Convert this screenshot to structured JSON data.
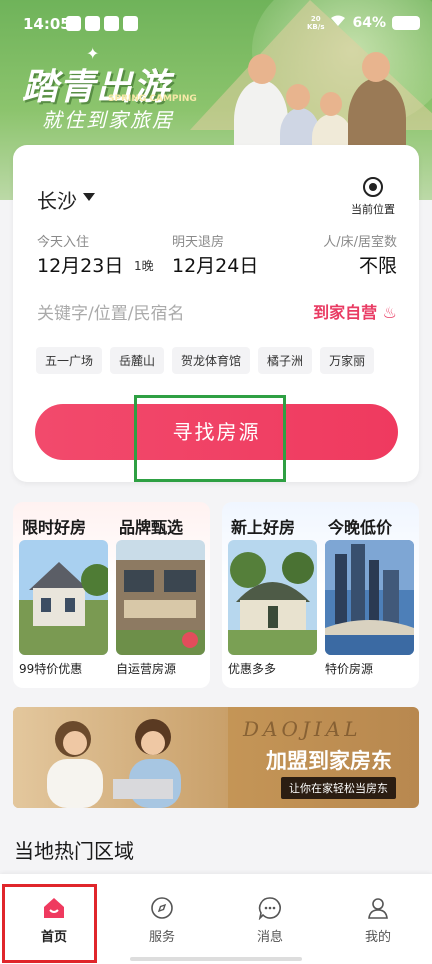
{
  "status_bar": {
    "time": "14:05",
    "net_speed": "20",
    "net_unit": "KB/s",
    "battery": "64%"
  },
  "hero": {
    "slogan_main": "踏青出游",
    "slogan_en": "SPRING CAMPING",
    "slogan_sub": "就住到家旅居"
  },
  "search": {
    "city": "长沙",
    "current_location": "当前位置",
    "checkin_label": "今天入住",
    "checkin_date": "12月23日",
    "nights": "1晚",
    "checkout_label": "明天退房",
    "checkout_date": "12月24日",
    "guests_label": "人/床/居室数",
    "guests_value": "不限",
    "keyword_placeholder": "关键字/位置/民宿名",
    "self_operated": "到家自营",
    "chips": [
      "五一广场",
      "岳麓山",
      "贺龙体育馆",
      "橘子洲",
      "万家丽"
    ],
    "search_button": "寻找房源"
  },
  "features": {
    "left": [
      {
        "title": "限时好房",
        "subtitle": "99特价优惠"
      },
      {
        "title": "品牌甄选",
        "subtitle": "自运营房源"
      }
    ],
    "right": [
      {
        "title": "新上好房",
        "subtitle": "优惠多多"
      },
      {
        "title": "今晚低价",
        "subtitle": "特价房源"
      }
    ]
  },
  "banner": {
    "script": "DAOJIAL",
    "title": "加盟到家房东",
    "subtitle": "让你在家轻松当房东"
  },
  "section_title": "当地热门区域",
  "tabs": [
    {
      "label": "首页",
      "icon": "home-icon",
      "active": true
    },
    {
      "label": "服务",
      "icon": "compass-icon"
    },
    {
      "label": "消息",
      "icon": "chat-icon"
    },
    {
      "label": "我的",
      "icon": "person-icon"
    }
  ],
  "colors": {
    "accent": "#ef3a5f",
    "hero_green": "#8cc46d",
    "highlight_green": "#2ea043",
    "highlight_red": "#e0262b"
  }
}
